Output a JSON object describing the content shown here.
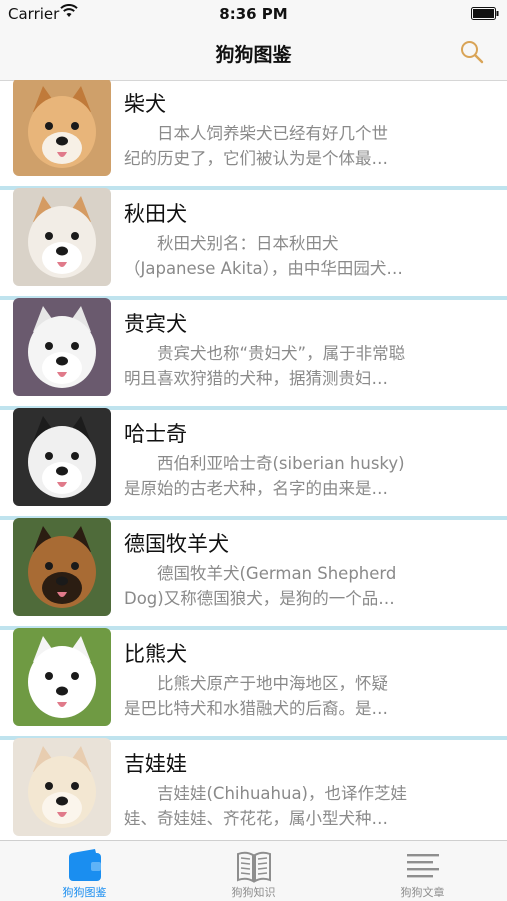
{
  "status_bar": {
    "carrier": "Carrier",
    "time": "8:36 PM"
  },
  "nav": {
    "title": "狗狗图鉴",
    "search_icon": "search-icon"
  },
  "colors": {
    "accent": "#1a8ef0",
    "separator": "#bfe3ee",
    "search_icon": "#d9a457"
  },
  "dogs": [
    {
      "name": "柴犬",
      "desc_line1": "日本人饲养柴犬已经有好几个世",
      "desc_line2": "纪的历史了，它们被认为是个体最…",
      "bg": "#cfa06a",
      "face": "#e8b57a",
      "ear": "#c07a3a",
      "muzzle": "#f7f0e6"
    },
    {
      "name": "秋田犬",
      "desc_line1": "秋田犬别名：日本秋田犬",
      "desc_line2": "（Japanese Akita），由中华田园犬…",
      "bg": "#d9d2c8",
      "face": "#f2ede6",
      "ear": "#d59b62",
      "muzzle": "#ffffff"
    },
    {
      "name": "贵宾犬",
      "desc_line1": "贵宾犬也称“贵妇犬”，属于非常聪",
      "desc_line2": "明且喜欢狩猎的犬种，据猜测贵妇…",
      "bg": "#6a5a6e",
      "face": "#f4f4f4",
      "ear": "#e6e6e6",
      "muzzle": "#ffffff"
    },
    {
      "name": "哈士奇",
      "desc_line1": "西伯利亚哈士奇(siberian husky)",
      "desc_line2": "是原始的古老犬种，名字的由来是…",
      "bg": "#2e2e2e",
      "face": "#f0f0f0",
      "ear": "#1c1c1c",
      "muzzle": "#ffffff"
    },
    {
      "name": "德国牧羊犬",
      "desc_line1": "德国牧羊犬(German Shepherd",
      "desc_line2": "Dog)又称德国狼犬，是狗的一个品…",
      "bg": "#4f6b3a",
      "face": "#a86b34",
      "ear": "#2b1d12",
      "muzzle": "#2b1d12"
    },
    {
      "name": "比熊犬",
      "desc_line1": "比熊犬原产于地中海地区，怀疑",
      "desc_line2": "是巴比特犬和水猎融犬的后裔。是…",
      "bg": "#6f9a43",
      "face": "#ffffff",
      "ear": "#f4f4f4",
      "muzzle": "#ffffff"
    },
    {
      "name": "吉娃娃",
      "desc_line1": "吉娃娃(Chihuahua)，也译作芝娃",
      "desc_line2": "娃、奇娃娃、齐花花，属小型犬种…",
      "bg": "#e9e2d8",
      "face": "#f3e7d2",
      "ear": "#e8cdb0",
      "muzzle": "#fbf5ec"
    }
  ],
  "tabs": [
    {
      "label": "狗狗图鉴",
      "icon": "wallet-icon",
      "active": true
    },
    {
      "label": "狗狗知识",
      "icon": "book-icon",
      "active": false
    },
    {
      "label": "狗狗文章",
      "icon": "article-lines-icon",
      "active": false
    }
  ]
}
